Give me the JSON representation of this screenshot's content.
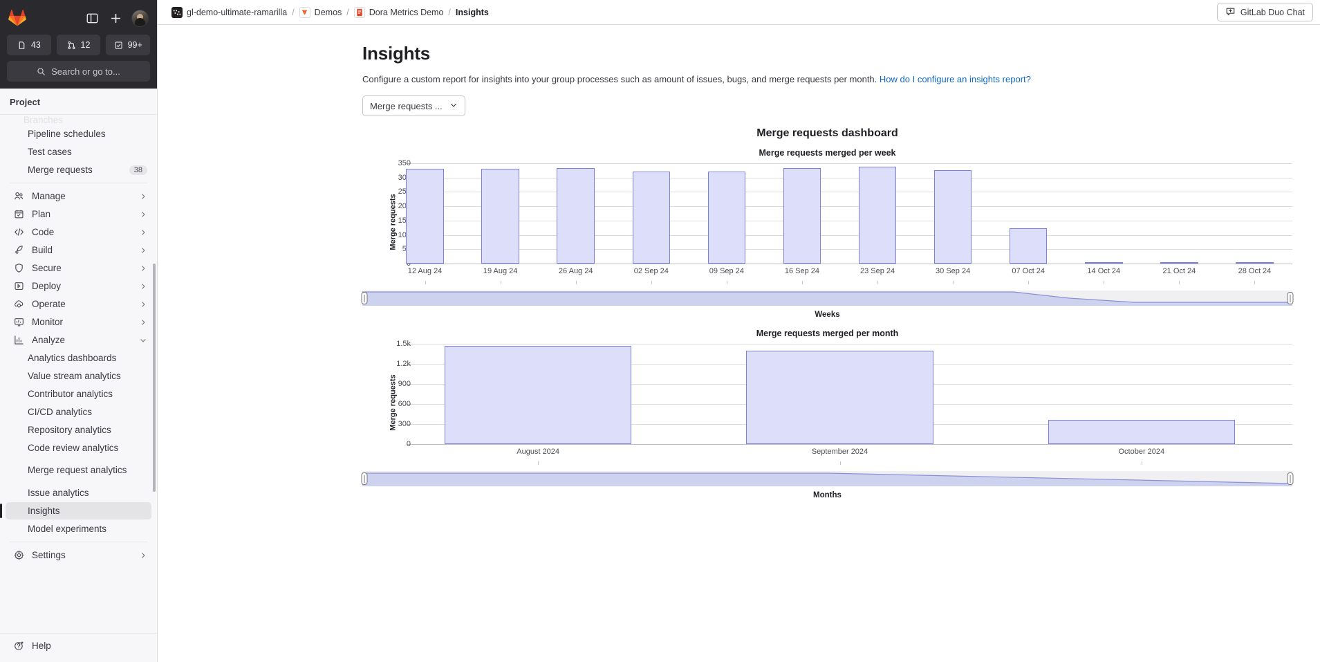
{
  "sidebar": {
    "counters": [
      {
        "icon": "issues-icon",
        "value": "43"
      },
      {
        "icon": "merge-request-icon",
        "value": "12"
      },
      {
        "icon": "todo-icon",
        "value": "99+"
      }
    ],
    "search_placeholder": "Search or go to...",
    "section_title": "Project",
    "faded_item": "Branches",
    "items": [
      {
        "label": "Pipeline schedules",
        "type": "sub"
      },
      {
        "label": "Test cases",
        "type": "sub"
      },
      {
        "label": "Merge requests",
        "type": "sub",
        "badge": "38"
      }
    ],
    "groups": [
      {
        "label": "Manage",
        "icon": "users-icon",
        "expandable": true
      },
      {
        "label": "Plan",
        "icon": "calendar-icon",
        "expandable": true
      },
      {
        "label": "Code",
        "icon": "code-icon",
        "expandable": true
      },
      {
        "label": "Build",
        "icon": "rocket-icon",
        "expandable": true
      },
      {
        "label": "Secure",
        "icon": "shield-icon",
        "expandable": true
      },
      {
        "label": "Deploy",
        "icon": "deploy-icon",
        "expandable": true
      },
      {
        "label": "Operate",
        "icon": "cloud-gear-icon",
        "expandable": true
      },
      {
        "label": "Monitor",
        "icon": "monitor-icon",
        "expandable": true
      },
      {
        "label": "Analyze",
        "icon": "chart-icon",
        "expandable": true,
        "expanded": true
      }
    ],
    "analyze_children": [
      {
        "label": "Analytics dashboards"
      },
      {
        "label": "Value stream analytics"
      },
      {
        "label": "Contributor analytics"
      },
      {
        "label": "CI/CD analytics"
      },
      {
        "label": "Repository analytics"
      },
      {
        "label": "Code review analytics"
      },
      {
        "label": "Merge request analytics",
        "two_line": true
      },
      {
        "label": "Issue analytics"
      },
      {
        "label": "Insights",
        "active": true
      },
      {
        "label": "Model experiments"
      }
    ],
    "settings": {
      "label": "Settings",
      "icon": "gear-icon"
    },
    "help": {
      "label": "Help",
      "icon": "help-icon"
    }
  },
  "topbar": {
    "breadcrumb": [
      {
        "label": "gl-demo-ultimate-ramarilla",
        "icon": "project-avatar-icon"
      },
      {
        "label": "Demos",
        "icon": "demos-avatar-icon"
      },
      {
        "label": "Dora Metrics Demo",
        "icon": "dora-avatar-icon"
      },
      {
        "label": "Insights",
        "current": true
      }
    ],
    "separator": "/",
    "duo_chat_label": "GitLab Duo Chat"
  },
  "page": {
    "title": "Insights",
    "description": "Configure a custom report for insights into your group processes such as amount of issues, bugs, and merge requests per month.",
    "help_link": "How do I configure an insights report?",
    "dropdown_label": "Merge requests ...",
    "dashboard_title": "Merge requests dashboard"
  },
  "chart_data": [
    {
      "type": "bar",
      "title": "Merge requests merged per week",
      "xlabel": "Weeks",
      "ylabel": "Merge requests",
      "categories": [
        "12 Aug 24",
        "19 Aug 24",
        "26 Aug 24",
        "02 Sep 24",
        "09 Sep 24",
        "16 Sep 24",
        "23 Sep 24",
        "30 Sep 24",
        "07 Oct 24",
        "14 Oct 24",
        "21 Oct 24",
        "28 Oct 24"
      ],
      "values": [
        331,
        331,
        334,
        322,
        322,
        332,
        337,
        327,
        124,
        2,
        2,
        2
      ],
      "ylim": [
        0,
        350
      ],
      "yticks": [
        0,
        50,
        100,
        150,
        200,
        250,
        300,
        350
      ],
      "ytick_labels": [
        "0",
        "50",
        "100",
        "150",
        "200",
        "250",
        "300",
        "350"
      ],
      "grid": true,
      "legend": "none",
      "bar_fill": "#dcdefa",
      "bar_border": "#7b7fdd"
    },
    {
      "type": "bar",
      "title": "Merge requests merged per month",
      "xlabel": "Months",
      "ylabel": "Merge requests",
      "categories": [
        "August 2024",
        "September 2024",
        "October 2024"
      ],
      "values": [
        1465,
        1400,
        360
      ],
      "ylim": [
        0,
        1500
      ],
      "yticks": [
        0,
        300,
        600,
        900,
        1200,
        1500
      ],
      "ytick_labels": [
        "0",
        "300",
        "600",
        "900",
        "1.2k",
        "1.5k"
      ],
      "grid": true,
      "legend": "none",
      "bar_fill": "#dcdefa",
      "bar_border": "#7b7fdd"
    }
  ]
}
